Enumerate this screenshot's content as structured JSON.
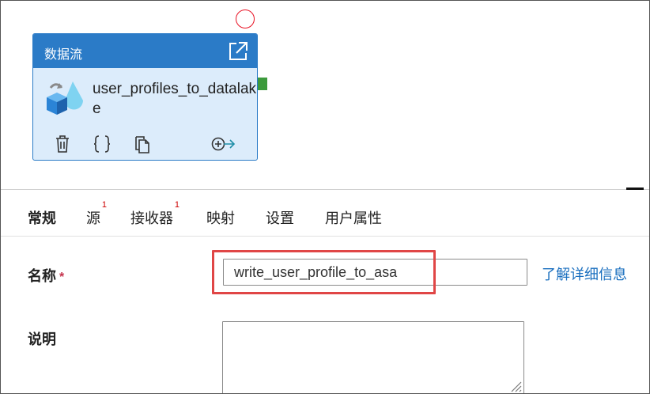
{
  "activity": {
    "type_label": "数据流",
    "name": "user_profiles_to_datalake",
    "icons": {
      "open": "open-external-icon",
      "dataflow": "dataflow-icon",
      "delete": "trash-icon",
      "code": "braces-icon",
      "copy": "copy-icon",
      "connect": "add-output-arrow-icon"
    },
    "header_color": "#2b7bc7",
    "body_color": "#dcecfb"
  },
  "tabs": [
    {
      "label": "常规",
      "badge": "",
      "active": true
    },
    {
      "label": "源",
      "badge": "1",
      "active": false
    },
    {
      "label": "接收器",
      "badge": "1",
      "active": false
    },
    {
      "label": "映射",
      "badge": "",
      "active": false
    },
    {
      "label": "设置",
      "badge": "",
      "active": false
    },
    {
      "label": "用户属性",
      "badge": "",
      "active": false
    }
  ],
  "form": {
    "name_label": "名称",
    "required_mark": "*",
    "name_value": "write_user_profile_to_asa",
    "learn_more": "了解详细信息",
    "description_label": "说明",
    "description_value": ""
  },
  "colors": {
    "accent": "#2b7bc7",
    "highlight_box": "#e04646",
    "link": "#1a6fbf",
    "success_handle": "#3c9a3c",
    "badge": "#cc0000"
  }
}
